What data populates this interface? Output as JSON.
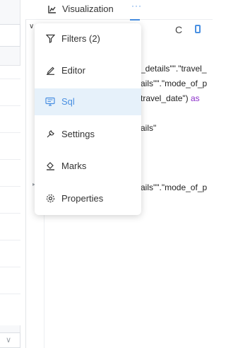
{
  "header": {
    "title": "Visualization",
    "more_label": "···"
  },
  "menu": {
    "items": [
      {
        "label": "Filters (2)",
        "icon": "filter-icon"
      },
      {
        "label": "Editor",
        "icon": "pen-icon"
      },
      {
        "label": "Sql",
        "icon": "monitor-icon",
        "active": true
      },
      {
        "label": "Settings",
        "icon": "wrench-icon"
      },
      {
        "label": "Marks",
        "icon": "paint-bucket-icon"
      },
      {
        "label": "Properties",
        "icon": "gear-icon"
      }
    ]
  },
  "code": {
    "lines": [
      "_details\"\".\"travel_",
      "ails\"\".\"mode_of_p",
      "travel_date\") ",
      "ails\"",
      "ails\"\".\"mode_of_p"
    ],
    "alias_keyword": "as"
  },
  "colors": {
    "accent": "#4a90e2",
    "active_bg": "#e6f1fa",
    "alias": "#8b2fc9"
  }
}
